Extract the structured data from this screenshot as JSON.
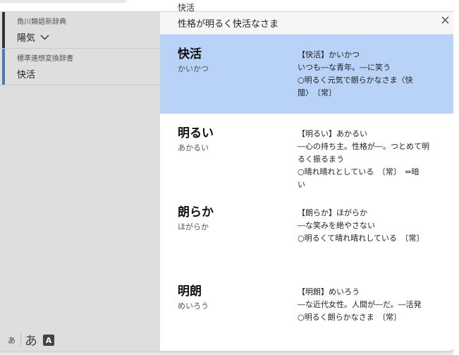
{
  "background": {
    "doc_text": "快活"
  },
  "header": {
    "title": "性格が明るく快活なさま"
  },
  "sidebar": {
    "sections": [
      {
        "dict": "角川類語新辞典",
        "word": "陽気",
        "has_dropdown": true
      },
      {
        "dict": "標準連想変換辞書",
        "word": "快活",
        "has_dropdown": false
      }
    ],
    "footer": {
      "small_kana": "あ",
      "large_kana": "あ",
      "dict_icon_letter": "A"
    }
  },
  "entries": [
    {
      "word": "快活",
      "reading": "かいかつ",
      "selected": true,
      "definition": [
        "【快活】かいかつ",
        "いつも―な青年。―に笑う",
        "○明るく元気で朗らかなさま〈快",
        "闊〉　〔常〕"
      ]
    },
    {
      "word": "明るい",
      "reading": "あかるい",
      "selected": false,
      "definition": [
        "【明るい】あかるい",
        "―心の持ち主。性格が―。つとめて明",
        "るく振るまう",
        "○晴れ晴れとしている　〔常〕　⇔暗",
        "い"
      ]
    },
    {
      "word": "朗らか",
      "reading": "ほがらか",
      "selected": false,
      "definition": [
        "【朗らか】ほがらか",
        "―な笑みを絶やさない",
        "○明るくて晴れ晴れしている　〔常〕"
      ]
    },
    {
      "word": "明朗",
      "reading": "めいろう",
      "selected": false,
      "definition": [
        "【明朗】めいろう",
        "―な近代女性。人間が―だ。―活発",
        "○明るく朗らかなさま　〔常〕"
      ]
    }
  ],
  "colors": {
    "selected_bg": "#b8d3f7",
    "sidebar_bg": "#dedede",
    "accent_bar": "#4a7ab8"
  }
}
